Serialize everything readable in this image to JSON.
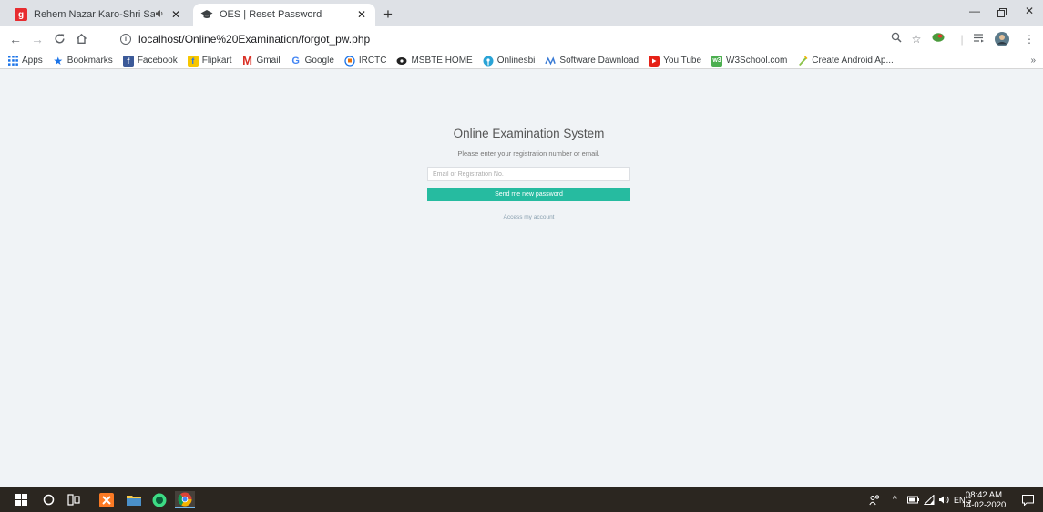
{
  "browser": {
    "tabs": [
      {
        "title": "Rehem Nazar Karo-Shri Sai K",
        "favicon": "gaana-icon",
        "favicon_color": "#e72c30",
        "audio": true
      },
      {
        "title": "OES | Reset Password",
        "favicon": "graduation-cap-icon",
        "active": true
      }
    ],
    "url": "localhost/Online%20Examination/forgot_pw.php"
  },
  "bookmarks": [
    {
      "label": "Apps",
      "icon": "apps-grid-icon",
      "color": "#1a73e8"
    },
    {
      "label": "Bookmarks",
      "icon": "star-icon",
      "color": "#1a73e8"
    },
    {
      "label": "Facebook",
      "icon": "facebook-icon",
      "color": "#3b5998"
    },
    {
      "label": "Flipkart",
      "icon": "flipkart-icon",
      "color": "#f7c600"
    },
    {
      "label": "Gmail",
      "icon": "gmail-icon",
      "color": "#d93025"
    },
    {
      "label": "Google",
      "icon": "google-icon",
      "color": "#4285f4"
    },
    {
      "label": "IRCTC",
      "icon": "irctc-icon",
      "color": "#1a73e8"
    },
    {
      "label": "MSBTE HOME",
      "icon": "msbte-icon",
      "color": "#222222"
    },
    {
      "label": "Onlinesbi",
      "icon": "sbi-icon",
      "color": "#29a3d6"
    },
    {
      "label": "Software Dawnload",
      "icon": "software-icon",
      "color": "#3a7bd5"
    },
    {
      "label": "You Tube",
      "icon": "youtube-icon",
      "color": "#e62117"
    },
    {
      "label": "W3School.com",
      "icon": "w3schools-icon",
      "color": "#4caf50"
    },
    {
      "label": "Create Android Ap...",
      "icon": "android-icon",
      "color": "#8bc34a"
    }
  ],
  "form": {
    "title": "Online Examination System",
    "subtitle": "Please enter your registration number or email.",
    "input_placeholder": "Email or Registration No.",
    "button_label": "Send me new password",
    "link_label": "Access my account"
  },
  "taskbar": {
    "language": "ENG",
    "time": "08:42 AM",
    "date": "14-02-2020"
  },
  "colors": {
    "accent": "#26bba0",
    "page_bg": "#f0f3f6",
    "taskbar_bg": "#2b2620"
  }
}
